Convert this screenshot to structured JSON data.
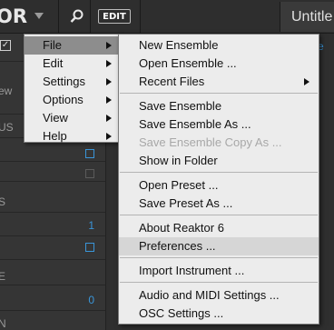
{
  "app": {
    "logo_text": "OR",
    "edit_label": "EDIT",
    "title": "Untitle"
  },
  "left_panel": {
    "rows": [
      {
        "label": "ew"
      },
      {
        "label": "US"
      },
      {
        "label": "S"
      },
      {
        "label": "E"
      },
      {
        "label": "N"
      }
    ],
    "values": [
      "1",
      "0"
    ]
  },
  "right_area": {
    "tail_text": "e"
  },
  "main_menu": {
    "items": [
      {
        "label": "File"
      },
      {
        "label": "Edit"
      },
      {
        "label": "Settings"
      },
      {
        "label": "Options"
      },
      {
        "label": "View"
      },
      {
        "label": "Help"
      }
    ]
  },
  "file_menu": {
    "items": [
      {
        "label": "New Ensemble"
      },
      {
        "label": "Open Ensemble ..."
      },
      {
        "label": "Recent Files"
      },
      {
        "label": "Save Ensemble"
      },
      {
        "label": "Save Ensemble As ..."
      },
      {
        "label": "Save Ensemble Copy As ..."
      },
      {
        "label": "Show in Folder"
      },
      {
        "label": "Open Preset ..."
      },
      {
        "label": "Save Preset As ..."
      },
      {
        "label": "About Reaktor 6"
      },
      {
        "label": "Preferences ..."
      },
      {
        "label": "Import Instrument ..."
      },
      {
        "label": "Audio and MIDI Settings ..."
      },
      {
        "label": "OSC Settings ..."
      }
    ]
  },
  "colors": {
    "accent_blue": "#3a95d8",
    "menu_bg": "#ececec",
    "menu_active": "#8d8d8d"
  }
}
